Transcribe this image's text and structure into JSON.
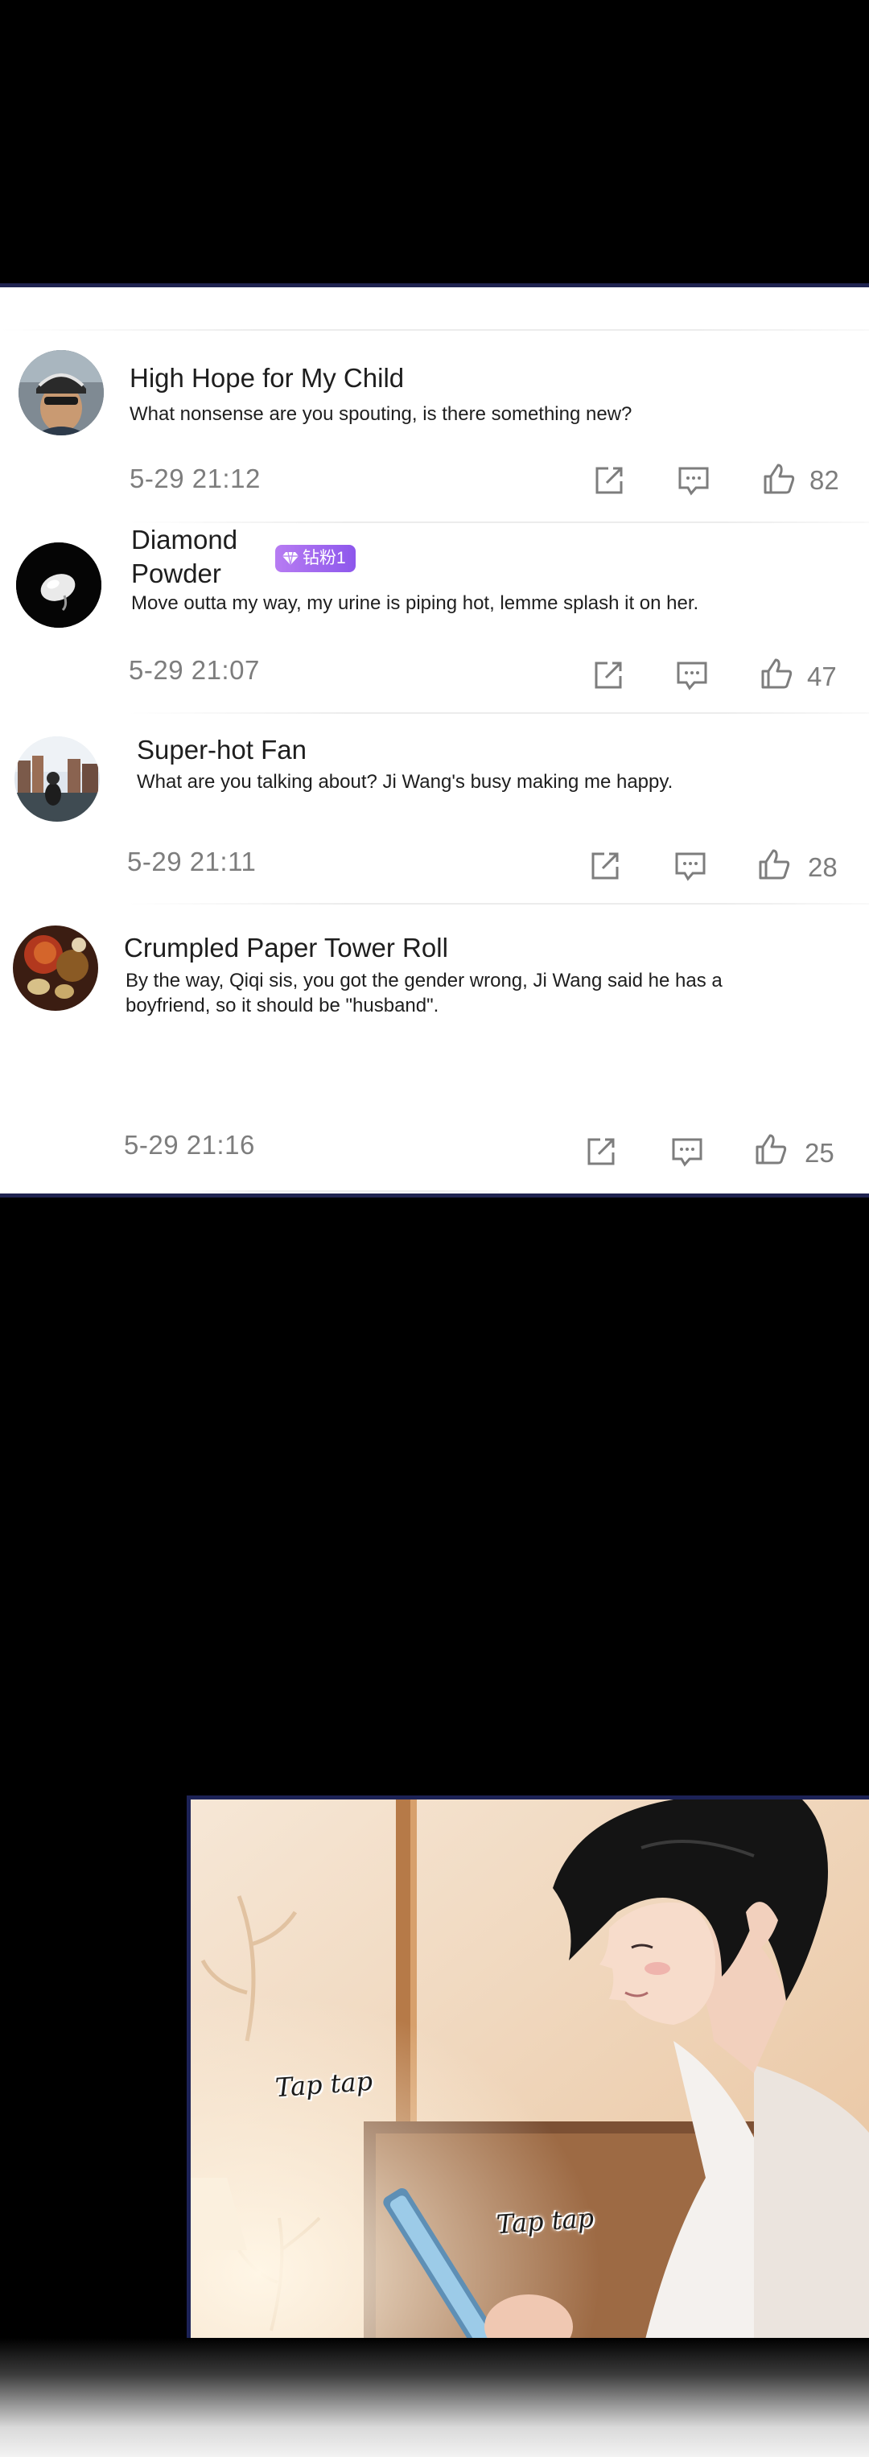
{
  "comments": [
    {
      "username": "High Hope for My Child",
      "text": "What nonsense are you spouting, is there something new?",
      "time": "5-29 21:12",
      "likes": "82",
      "avatar_icon": "person-with-helmet-avatar"
    },
    {
      "username": "Diamond Powder",
      "username_lines": [
        "Diamond",
        "Powder"
      ],
      "badge": "钻粉1",
      "badge_icon": "diamond-icon",
      "text": "Move outta my way, my urine is piping hot, lemme splash it on her.",
      "time": "5-29 21:07",
      "likes": "47",
      "avatar_icon": "white-egg-avatar"
    },
    {
      "username": "Super-hot Fan",
      "text": "What are you talking about? Ji Wang's busy making me happy.",
      "time": "5-29 21:11",
      "likes": "28",
      "avatar_icon": "city-photo-avatar"
    },
    {
      "username": "Crumpled Paper Tower Roll",
      "text_lines": [
        "By the way, Qiqi sis, you got the gender wrong, Ji Wang said he has a",
        "boyfriend, so it should be \"husband\"."
      ],
      "time": "5-29 21:16",
      "likes": "25",
      "avatar_icon": "food-photo-avatar"
    }
  ],
  "actions": {
    "share_icon": "share-icon",
    "reply_icon": "comment-icon",
    "like_icon": "thumbs-up-icon"
  },
  "comic": {
    "sfx_1": "Tap tap",
    "sfx_2": "Tap tap"
  },
  "colors": {
    "panel_border": "#1f2350",
    "badge": "#a06cf0",
    "meta_text": "#7d7d7d"
  }
}
